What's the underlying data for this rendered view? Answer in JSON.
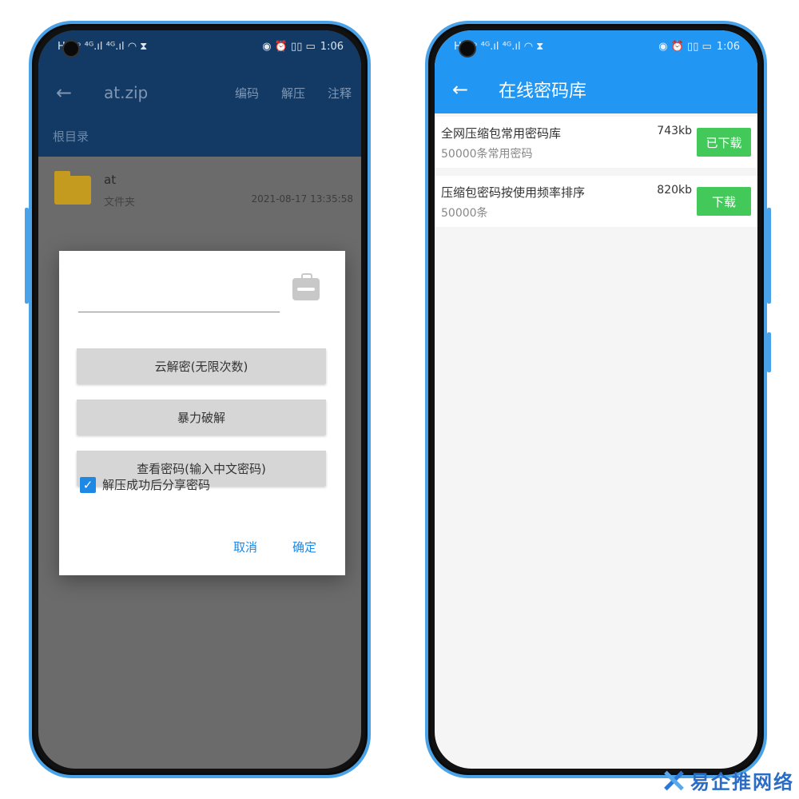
{
  "status": {
    "time": "1:06",
    "left_icons": "HD ᵖ ⁴ᴳ.ıl ⁴ᴳ.ıl ◠ ⧗",
    "right_icons": "◉ ⏰ ▯▯ ▭"
  },
  "left": {
    "title": "at.zip",
    "actions": [
      "编码",
      "解压",
      "注释"
    ],
    "breadcrumb": "根目录",
    "item": {
      "name": "at",
      "type": "文件夹",
      "date": "2021-08-17 13:35:58"
    },
    "dialog": {
      "buttons": [
        "云解密(无限次数)",
        "暴力破解",
        "查看密码(输入中文密码)"
      ],
      "checkbox_label": "解压成功后分享密码",
      "cancel": "取消",
      "confirm": "确定"
    }
  },
  "right": {
    "title": "在线密码库",
    "items": [
      {
        "title": "全网压缩包常用密码库",
        "subtitle": "50000条常用密码",
        "size": "743kb",
        "button": "已下载"
      },
      {
        "title": "压缩包密码按使用频率排序",
        "subtitle": "50000条",
        "size": "820kb",
        "button": "下载"
      }
    ]
  },
  "logo": {
    "text": "易企推网络"
  },
  "colors": {
    "dark_header": "#123a64",
    "blue_header": "#2196f3",
    "green": "#43c95a",
    "accent": "#1e88e5"
  }
}
